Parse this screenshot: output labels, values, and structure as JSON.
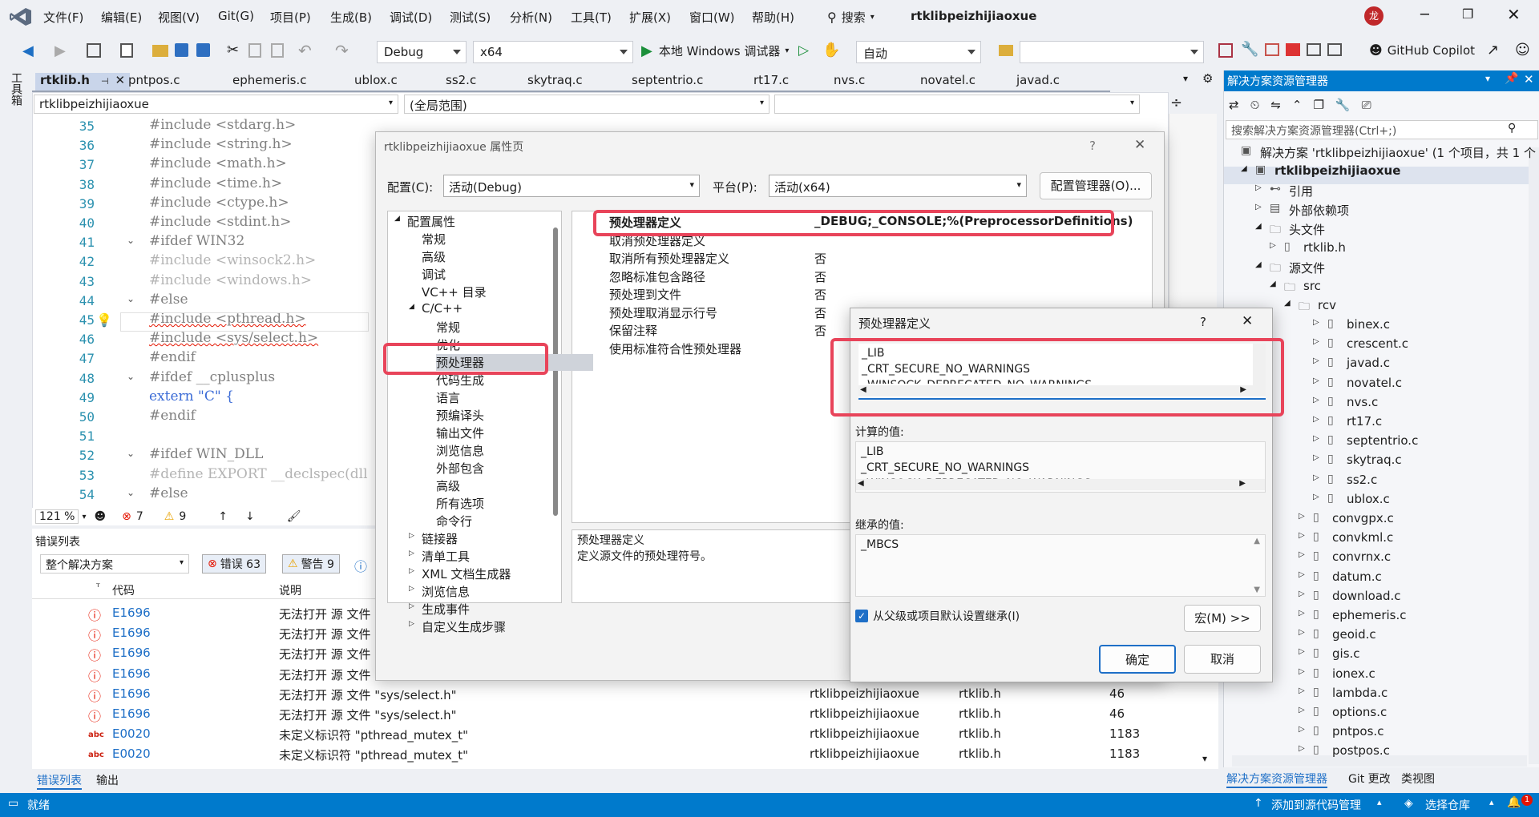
{
  "menu": {
    "items": [
      "文件(F)",
      "编辑(E)",
      "视图(V)",
      "Git(G)",
      "项目(P)",
      "生成(B)",
      "调试(D)",
      "测试(S)",
      "分析(N)",
      "工具(T)",
      "扩展(X)",
      "窗口(W)",
      "帮助(H)"
    ],
    "search": "搜索",
    "solution_title": "rtklibpeizhijiaoxue",
    "avatar": "龙"
  },
  "toolbar": {
    "config": "Debug",
    "platform": "x64",
    "run_label": "本地 Windows 调试器",
    "auto": "自动",
    "copilot": "GitHub Copilot"
  },
  "tabs": [
    "rtklib.h",
    "pntpos.c",
    "ephemeris.c",
    "ublox.c",
    "ss2.c",
    "skytraq.c",
    "septentrio.c",
    "rt17.c",
    "nvs.c",
    "novatel.c",
    "javad.c"
  ],
  "left_strip": "工具箱",
  "editor": {
    "project_combo": "rtklibpeizhijiaoxue",
    "scope_combo": "(全局范围)",
    "zoom": "121 %",
    "errors": "7",
    "warnings": "9",
    "lines": [
      {
        "n": "35",
        "t": "#include <stdarg.h>"
      },
      {
        "n": "36",
        "t": "#include <string.h>"
      },
      {
        "n": "37",
        "t": "#include <math.h>"
      },
      {
        "n": "38",
        "t": "#include <time.h>"
      },
      {
        "n": "39",
        "t": "#include <ctype.h>"
      },
      {
        "n": "40",
        "t": "#include <stdint.h>"
      },
      {
        "n": "41",
        "t": "#ifdef WIN32"
      },
      {
        "n": "42",
        "t": "#include <winsock2.h>"
      },
      {
        "n": "43",
        "t": "#include <windows.h>"
      },
      {
        "n": "44",
        "t": "#else"
      },
      {
        "n": "45",
        "t": "#include <pthread.h>"
      },
      {
        "n": "46",
        "t": "#include <sys/select.h>"
      },
      {
        "n": "47",
        "t": "#endif"
      },
      {
        "n": "48",
        "t": "#ifdef __cplusplus"
      },
      {
        "n": "49",
        "t": "extern \"C\" {"
      },
      {
        "n": "50",
        "t": "#endif"
      },
      {
        "n": "51",
        "t": ""
      },
      {
        "n": "52",
        "t": "#ifdef WIN_DLL"
      },
      {
        "n": "53",
        "t": "#define EXPORT __declspec(dll"
      },
      {
        "n": "54",
        "t": "#else"
      }
    ]
  },
  "errorlist": {
    "title": "错误列表",
    "scope": "整个解决方案",
    "errors_btn": "错误 63",
    "warnings_btn": "警告 9",
    "col_code": "代码",
    "col_desc": "说明",
    "rows": [
      {
        "code": "E1696",
        "desc": "无法打开 源 文件 \"",
        "proj": "",
        "file": "",
        "line": ""
      },
      {
        "code": "E1696",
        "desc": "无法打开 源 文件 \"",
        "proj": "",
        "file": "",
        "line": ""
      },
      {
        "code": "E1696",
        "desc": "无法打开 源 文件 \"",
        "proj": "",
        "file": "",
        "line": ""
      },
      {
        "code": "E1696",
        "desc": "无法打开 源 文件 \"",
        "proj": "",
        "file": "",
        "line": ""
      },
      {
        "code": "E1696",
        "desc": "无法打开 源 文件 \"sys/select.h\"",
        "proj": "rtklibpeizhijiaoxue",
        "file": "rtklib.h",
        "line": "46"
      },
      {
        "code": "E1696",
        "desc": "无法打开 源 文件 \"sys/select.h\"",
        "proj": "rtklibpeizhijiaoxue",
        "file": "rtklib.h",
        "line": "46"
      },
      {
        "code": "E0020",
        "desc": "未定义标识符 \"pthread_mutex_t\"",
        "proj": "rtklibpeizhijiaoxue",
        "file": "rtklib.h",
        "line": "1183"
      },
      {
        "code": "E0020",
        "desc": "未定义标识符 \"pthread_mutex_t\"",
        "proj": "rtklibpeizhijiaoxue",
        "file": "rtklib.h",
        "line": "1183"
      }
    ],
    "tab_errors": "错误列表",
    "tab_output": "输出"
  },
  "solution": {
    "title": "解决方案资源管理器",
    "search_placeholder": "搜索解决方案资源管理器(Ctrl+;)",
    "root": "解决方案 'rtklibpeizhijiaoxue' (1 个项目，共 1 个",
    "project": "rtklibpeizhijiaoxue",
    "refs": "引用",
    "ext": "外部依赖项",
    "headers": "头文件",
    "header_file": "rtklib.h",
    "sources": "源文件",
    "src": "src",
    "rcv": "rcv",
    "rcv_files": [
      "binex.c",
      "crescent.c",
      "javad.c",
      "novatel.c",
      "nvs.c",
      "rt17.c",
      "septentrio.c",
      "skytraq.c",
      "ss2.c",
      "ublox.c"
    ],
    "src_files": [
      "convgpx.c",
      "convkml.c",
      "convrnx.c",
      "datum.c",
      "download.c",
      "ephemeris.c",
      "geoid.c",
      "gis.c",
      "ionex.c",
      "lambda.c",
      "options.c",
      "pntpos.c",
      "postpos.c"
    ],
    "bottom_tabs": [
      "解决方案资源管理器",
      "Git 更改",
      "类视图"
    ]
  },
  "statusbar": {
    "ready": "就绪",
    "add_source": "添加到源代码管理",
    "select_repo": "选择仓库",
    "notif": "1"
  },
  "propdlg": {
    "title": "rtklibpeizhijiaoxue 属性页",
    "help": "?",
    "config_label": "配置(C):",
    "config_val": "活动(Debug)",
    "platform_label": "平台(P):",
    "platform_val": "活动(x64)",
    "config_mgr": "配置管理器(O)...",
    "tree": [
      {
        "t": "配置属性",
        "lvl": 0,
        "exp": "open"
      },
      {
        "t": "常规",
        "lvl": 1
      },
      {
        "t": "高级",
        "lvl": 1
      },
      {
        "t": "调试",
        "lvl": 1
      },
      {
        "t": "VC++ 目录",
        "lvl": 1
      },
      {
        "t": "C/C++",
        "lvl": 1,
        "exp": "open"
      },
      {
        "t": "常规",
        "lvl": 2
      },
      {
        "t": "优化",
        "lvl": 2
      },
      {
        "t": "预处理器",
        "lvl": 2,
        "sel": true
      },
      {
        "t": "代码生成",
        "lvl": 2
      },
      {
        "t": "语言",
        "lvl": 2
      },
      {
        "t": "预编译头",
        "lvl": 2
      },
      {
        "t": "输出文件",
        "lvl": 2
      },
      {
        "t": "浏览信息",
        "lvl": 2
      },
      {
        "t": "外部包含",
        "lvl": 2
      },
      {
        "t": "高级",
        "lvl": 2
      },
      {
        "t": "所有选项",
        "lvl": 2
      },
      {
        "t": "命令行",
        "lvl": 2
      },
      {
        "t": "链接器",
        "lvl": 1,
        "exp": "closed"
      },
      {
        "t": "清单工具",
        "lvl": 1,
        "exp": "closed"
      },
      {
        "t": "XML 文档生成器",
        "lvl": 1,
        "exp": "closed"
      },
      {
        "t": "浏览信息",
        "lvl": 1,
        "exp": "closed"
      },
      {
        "t": "生成事件",
        "lvl": 1,
        "exp": "closed"
      },
      {
        "t": "自定义生成步骤",
        "lvl": 1,
        "exp": "closed"
      }
    ],
    "props": [
      {
        "k": "预处理器定义",
        "v": "_DEBUG;_CONSOLE;%(PreprocessorDefinitions)"
      },
      {
        "k": "取消预处理器定义",
        "v": ""
      },
      {
        "k": "取消所有预处理器定义",
        "v": "否"
      },
      {
        "k": "忽略标准包含路径",
        "v": "否"
      },
      {
        "k": "预处理到文件",
        "v": "否"
      },
      {
        "k": "预处理取消显示行号",
        "v": "否"
      },
      {
        "k": "保留注释",
        "v": "否"
      },
      {
        "k": "使用标准符合性预处理器",
        "v": ""
      }
    ],
    "desc_title": "预处理器定义",
    "desc_text": "定义源文件的预处理符号。"
  },
  "subdlg": {
    "title": "预处理器定义",
    "help": "?",
    "edit_lines": [
      "_LIB",
      "_CRT_SECURE_NO_WARNINGS",
      "_WINSOCK_DEPRECATED_NO_WARNINGS"
    ],
    "computed_label": "计算的值:",
    "computed_lines": [
      "_LIB",
      "_CRT_SECURE_NO_WARNINGS",
      "_WINSOCK_DEPRECATED_NO_WARNINGS"
    ],
    "inherited_label": "继承的值:",
    "inherited_lines": [
      "_MBCS"
    ],
    "inherit_check": "从父级或项目默认设置继承(I)",
    "macro": "宏(M) >>",
    "ok": "确定",
    "cancel": "取消"
  },
  "colors": {
    "accent": "#007acc",
    "highlight": "#e8445a",
    "error": "#e51400",
    "warning": "#e8a200"
  }
}
